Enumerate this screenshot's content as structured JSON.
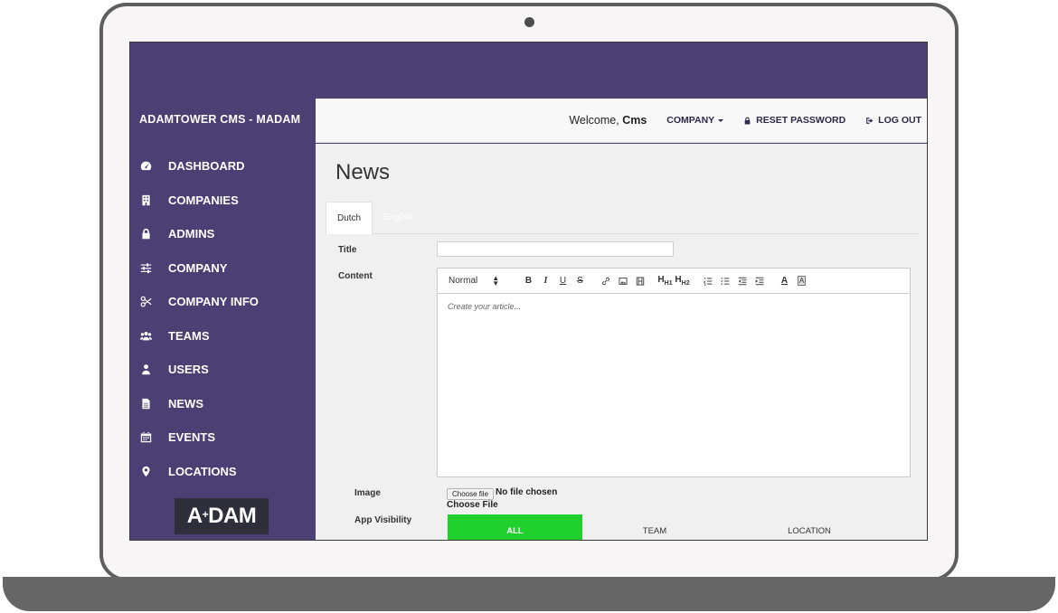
{
  "sidebar": {
    "brand": "ADAMTOWER CMS - MADAM",
    "items": [
      {
        "label": "DASHBOARD",
        "icon": "dashboard-icon"
      },
      {
        "label": "COMPANIES",
        "icon": "building-icon"
      },
      {
        "label": "ADMINS",
        "icon": "lock-icon"
      },
      {
        "label": "COMPANY",
        "icon": "sliders-icon"
      },
      {
        "label": "COMPANY INFO",
        "icon": "scissors-icon"
      },
      {
        "label": "TEAMS",
        "icon": "users-group-icon"
      },
      {
        "label": "USERS",
        "icon": "user-icon"
      },
      {
        "label": "NEWS",
        "icon": "document-icon"
      },
      {
        "label": "EVENTS",
        "icon": "calendar-icon"
      },
      {
        "label": "LOCATIONS",
        "icon": "map-marker-icon"
      }
    ],
    "logo": {
      "text_a": "A",
      "text_sup": "+",
      "text_rest": "DAM"
    }
  },
  "header": {
    "welcome_prefix": "Welcome,",
    "welcome_user": "Cms",
    "company_menu": "COMPANY",
    "reset_password": "RESET PASSWORD",
    "log_out": "LOG OUT"
  },
  "main": {
    "title": "News",
    "tabs": [
      {
        "label": "Dutch",
        "active": true
      },
      {
        "label": "English",
        "active": false
      }
    ],
    "form": {
      "title_label": "Title",
      "title_value": "",
      "content_label": "Content",
      "editor": {
        "format_select": "Normal",
        "placeholder": "Create your article...",
        "h1": "H1",
        "h2": "H2"
      },
      "image_label": "Image",
      "file_button": "Choose file",
      "file_status": "No file chosen",
      "choose_file_label": "Choose File",
      "visibility_label": "App Visibility",
      "visibility_options": [
        "ALL",
        "TEAM",
        "LOCATION"
      ],
      "visibility_selected": "ALL"
    }
  },
  "colors": {
    "sidebar_bg": "#4b3f74",
    "accent_green": "#20d02c",
    "main_bg": "#f0f0f0"
  }
}
